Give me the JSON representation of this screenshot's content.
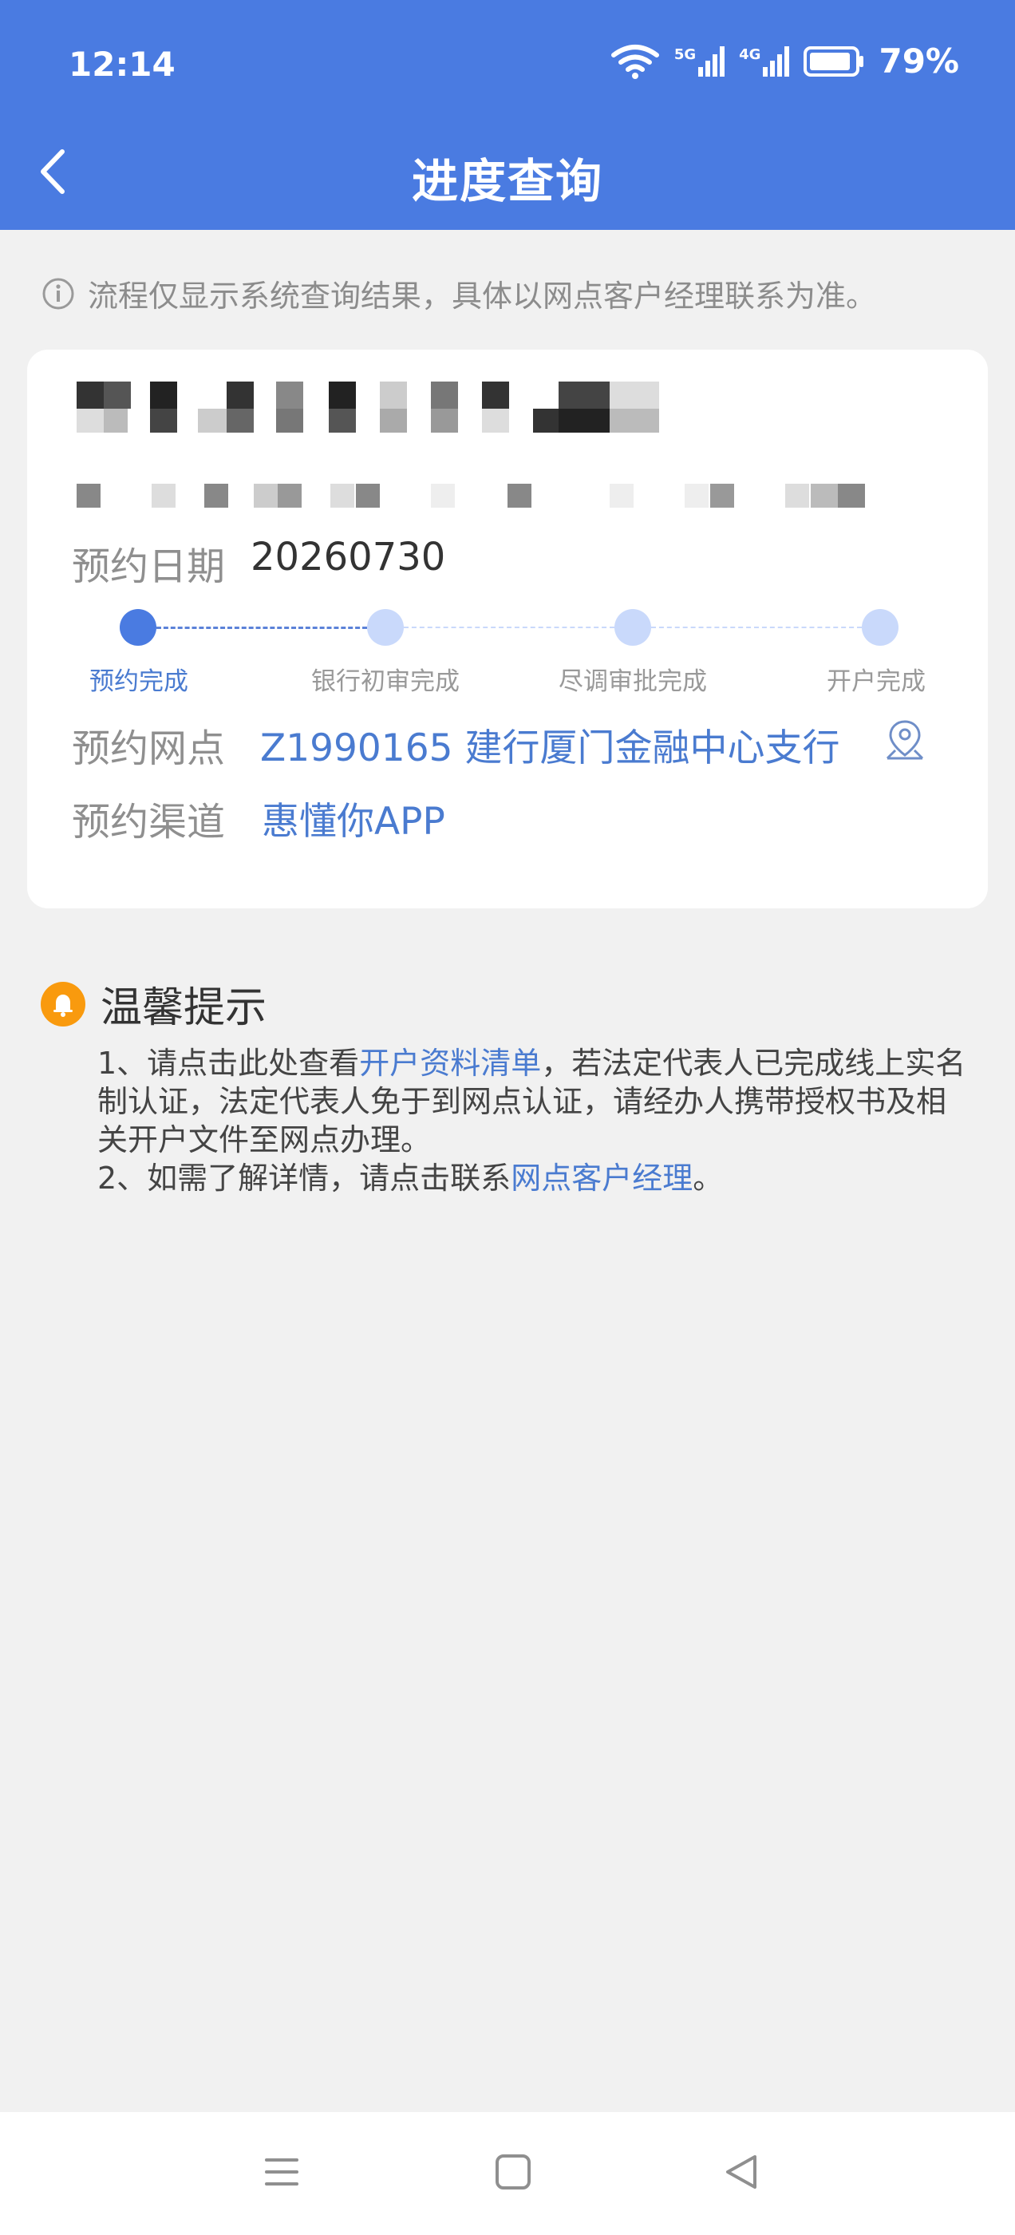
{
  "status_bar": {
    "time": "12:14",
    "signal_1": "5G",
    "signal_2": "4G",
    "battery": "79%"
  },
  "header": {
    "title": "进度查询"
  },
  "notice": {
    "text": "流程仅显示系统查询结果，具体以网点客户经理联系为准。"
  },
  "card": {
    "date_label": "预约日期",
    "date_value": "20260730",
    "steps": [
      {
        "label": "预约完成",
        "active": true
      },
      {
        "label": "银行初审完成",
        "active": false
      },
      {
        "label": "尽调审批完成",
        "active": false
      },
      {
        "label": "开户完成",
        "active": false
      }
    ],
    "branch_label": "预约网点",
    "branch_value": "Z1990165 建行厦门金融中心支行",
    "channel_label": "预约渠道",
    "channel_value": "惠懂你APP"
  },
  "tips": {
    "title": "温馨提示",
    "line1_prefix": "1、请点击此处查看",
    "line1_link": "开户资料清单",
    "line1_suffix": "，若法定代表人已完成线上实名制认证，法定代表人免于到网点认证，请经办人携带授权书及相关开户文件至网点办理。",
    "line2_prefix": "2、如需了解详情，请点击联系",
    "line2_link": "网点客户经理",
    "line2_suffix": "。"
  },
  "colors": {
    "header": "#4a7be1",
    "link": "#4a7bd0",
    "active_step": "#4a7be1",
    "inactive_step": "#c9d9fb",
    "bell": "#f99a0e"
  }
}
